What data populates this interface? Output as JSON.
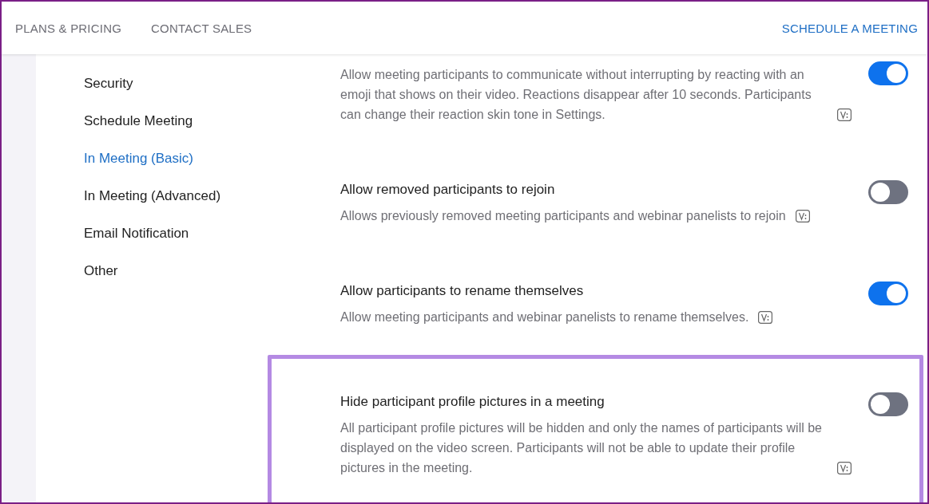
{
  "header": {
    "nav": [
      {
        "label": "PLANS & PRICING"
      },
      {
        "label": "CONTACT SALES"
      }
    ],
    "action": {
      "label": "SCHEDULE A MEETING"
    }
  },
  "sidebar": {
    "items": [
      {
        "label": "Security",
        "selected": false
      },
      {
        "label": "Schedule Meeting",
        "selected": false
      },
      {
        "label": "In Meeting (Basic)",
        "selected": true
      },
      {
        "label": "In Meeting (Advanced)",
        "selected": false
      },
      {
        "label": "Email Notification",
        "selected": false
      },
      {
        "label": "Other",
        "selected": false
      }
    ]
  },
  "settings": [
    {
      "description": "Allow meeting participants to communicate without interrupting by reacting with an emoji that shows on their video. Reactions disappear after 10 seconds. Participants can change their reaction skin tone in Settings.",
      "on": true,
      "highlighted": false
    },
    {
      "title": "Allow removed participants to rejoin",
      "description": "Allows previously removed meeting participants and webinar panelists to rejoin",
      "on": false,
      "highlighted": false
    },
    {
      "title": "Allow participants to rename themselves",
      "description": "Allow meeting participants and webinar panelists to rename themselves.",
      "on": true,
      "highlighted": false
    },
    {
      "title": "Hide participant profile pictures in a meeting",
      "description": "All participant profile pictures will be hidden and only the names of participants will be displayed on the video screen. Participants will not be able to update their profile pictures in the meeting.",
      "on": false,
      "highlighted": true
    }
  ]
}
